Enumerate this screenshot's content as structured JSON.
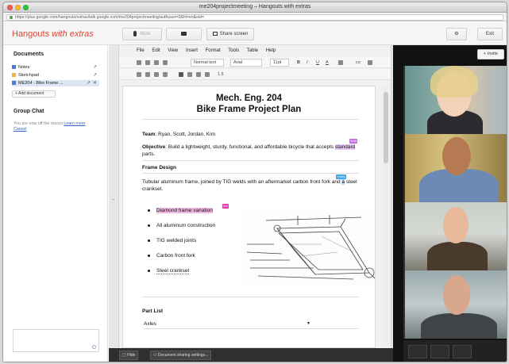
{
  "window": {
    "title": "me204projectmeeting – Hangouts with extras",
    "url": "https://plus.google.com/hangouts/extras/talk.google.com/me204projectmeeting/authuser=0&hl=en&eid="
  },
  "header": {
    "brand": "Hangouts",
    "brand_suffix": "with extras",
    "mic_label": "Mute",
    "screen_label": "Share screen",
    "exit_label": "Exit"
  },
  "documents": {
    "title": "Documents",
    "items": [
      {
        "label": "Notes",
        "color": "#4a7bd8"
      },
      {
        "label": "Sketchpad",
        "color": "#f1b33e"
      },
      {
        "label": "ME204 - Bike Frame ...",
        "color": "#4a7bd8"
      }
    ],
    "add_label": "+ Add document"
  },
  "group_chat": {
    "title": "Group Chat",
    "note_prefix": "You are now off the record",
    "learn_more": "Learn more",
    "cancel": "Cancel"
  },
  "editor": {
    "menu": [
      "File",
      "Edit",
      "View",
      "Insert",
      "Format",
      "Tools",
      "Table",
      "Help"
    ],
    "style_select": "Normal text",
    "font_select": "Arial",
    "size_select": "11pt",
    "toolbar_bold": "B",
    "toolbar_italic": "I",
    "toolbar_underline": "U",
    "toolbar_color": "A",
    "toolbar_link": "co",
    "toolbar_lines": "1.5",
    "doc_title_1": "Mech. Eng. 204",
    "doc_title_2": "Bike Frame Project Plan",
    "team_label": "Team",
    "team_value": ": Ryan, Scott, Jordan, Kim",
    "objective_label": "Objective",
    "objective_value": ": Build a lightweight, sturdy, functional, and affordable bicycle that accepts",
    "objective_highlight": "standard",
    "objective_end": "parts.",
    "frame_heading": "Frame Design",
    "frame_text_1": "Tubular aluminum frame, joined by TIG welds with an aftermarket carbon front fork and",
    "frame_highlight": "a",
    "frame_text_2": "steel",
    "frame_text_3": "crankset.",
    "bullets": [
      "Diamond frame variation",
      "All aluminum construction",
      "TIG welded joints",
      "Carbon front fork",
      "Steel crankset"
    ],
    "tag_1": "Scott",
    "tag_2": "Jordan",
    "tag_3": "Kim",
    "part_list": "Part List",
    "axles": "Axles"
  },
  "bottom_bar": {
    "hide": "Hide",
    "sharing": "Document sharing settings..."
  },
  "video": {
    "invite": "Invite"
  },
  "colors": {
    "brand": "#d34836",
    "highlight_purple": "#c36de6",
    "highlight_pink": "#e03bb4",
    "highlight_blue": "#3fa7e8"
  }
}
